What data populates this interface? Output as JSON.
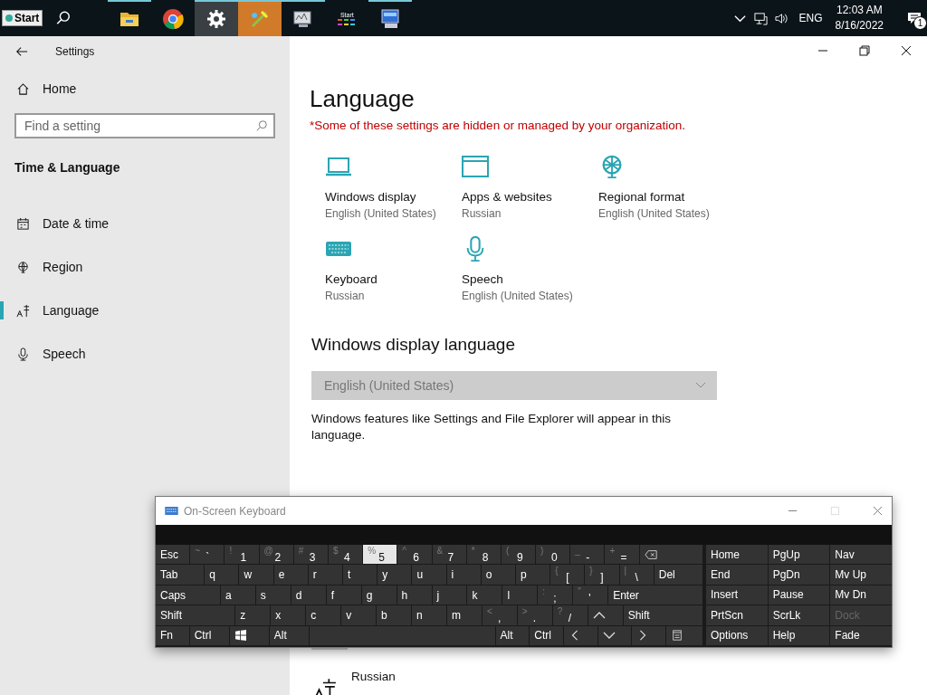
{
  "taskbar": {
    "start": "Start",
    "apps": [
      {
        "kind": "folder",
        "running": true,
        "selected": false,
        "flashing": false
      },
      {
        "kind": "chrome",
        "running": false,
        "selected": false,
        "flashing": false
      },
      {
        "kind": "gear",
        "running": true,
        "selected": true,
        "flashing": false
      },
      {
        "kind": "paint",
        "running": true,
        "selected": false,
        "flashing": true
      },
      {
        "kind": "monitor",
        "running": true,
        "selected": false,
        "flashing": false
      },
      {
        "kind": "grid",
        "label": "Start",
        "running": false,
        "selected": false,
        "flashing": false
      },
      {
        "kind": "computer",
        "running": true,
        "selected": false,
        "flashing": false
      }
    ],
    "tray": {
      "language": "ENG",
      "time": "12:03 AM",
      "date": "8/16/2022",
      "notifications": "1"
    }
  },
  "window": {
    "title": "Settings"
  },
  "sidebar": {
    "home": "Home",
    "search": {
      "placeholder": "Find a setting"
    },
    "section": "Time & Language",
    "items": [
      {
        "kind": "calendar",
        "label": "Date & time",
        "selected": false
      },
      {
        "kind": "globe",
        "label": "Region",
        "selected": false
      },
      {
        "kind": "language",
        "label": "Language",
        "selected": true
      },
      {
        "kind": "mic",
        "label": "Speech",
        "selected": false
      }
    ]
  },
  "main": {
    "heading": "Language",
    "notice": "*Some of these settings are hidden or managed by your organization.",
    "tiles": [
      {
        "kind": "laptop",
        "title": "Windows display",
        "value": "English (United States)"
      },
      {
        "kind": "window",
        "title": "Apps & websites",
        "value": "Russian"
      },
      {
        "kind": "globe",
        "title": "Regional format",
        "value": "English (United States)"
      },
      {
        "kind": "keyboard",
        "title": "Keyboard",
        "value": "Russian"
      },
      {
        "kind": "mic",
        "title": "Speech",
        "value": "English (United States)"
      }
    ],
    "display_language": {
      "heading": "Windows display language",
      "dropdown": {
        "value": "English (United States)",
        "disabled": true
      },
      "description": "Windows features like Settings and File Explorer will appear in this language."
    },
    "preferred": [
      {
        "name": "Russian"
      }
    ]
  },
  "osk": {
    "title": "On-Screen Keyboard",
    "rows": [
      {
        "keys": [
          {
            "label": "Esc",
            "pressed": false
          },
          {
            "label": "`",
            "shift": "~",
            "pressed": false
          },
          {
            "label": "1",
            "shift": "!",
            "pressed": false
          },
          {
            "label": "2",
            "shift": "@",
            "pressed": false
          },
          {
            "label": "3",
            "shift": "#",
            "pressed": false
          },
          {
            "label": "4",
            "shift": "$",
            "pressed": false
          },
          {
            "label": "5",
            "shift": "%",
            "pressed": true
          },
          {
            "label": "6",
            "shift": "^",
            "pressed": false
          },
          {
            "label": "7",
            "shift": "&",
            "pressed": false
          },
          {
            "label": "8",
            "shift": "*",
            "pressed": false
          },
          {
            "label": "9",
            "shift": "(",
            "pressed": false
          },
          {
            "label": "0",
            "shift": ")",
            "pressed": false
          },
          {
            "label": "-",
            "shift": "_",
            "pressed": false
          },
          {
            "label": "=",
            "shift": "+",
            "pressed": false
          },
          {
            "kind": "backspace",
            "pressed": false
          }
        ]
      },
      {
        "keys": [
          {
            "label": "Tab",
            "pressed": false
          },
          {
            "label": "q",
            "pressed": false
          },
          {
            "label": "w",
            "pressed": false
          },
          {
            "label": "e",
            "pressed": false
          },
          {
            "label": "r",
            "pressed": false
          },
          {
            "label": "t",
            "pressed": false
          },
          {
            "label": "y",
            "pressed": false
          },
          {
            "label": "u",
            "pressed": false
          },
          {
            "label": "i",
            "pressed": false
          },
          {
            "label": "o",
            "pressed": false
          },
          {
            "label": "p",
            "pressed": false
          },
          {
            "label": "[",
            "shift": "{",
            "pressed": false
          },
          {
            "label": "]",
            "shift": "}",
            "pressed": false
          },
          {
            "label": "\\",
            "shift": "|",
            "pressed": false
          },
          {
            "label": "Del",
            "pressed": false
          }
        ]
      },
      {
        "keys": [
          {
            "label": "Caps",
            "pressed": false
          },
          {
            "label": "a",
            "pressed": false
          },
          {
            "label": "s",
            "pressed": false
          },
          {
            "label": "d",
            "pressed": false
          },
          {
            "label": "f",
            "pressed": false
          },
          {
            "label": "g",
            "pressed": false
          },
          {
            "label": "h",
            "pressed": false
          },
          {
            "label": "j",
            "pressed": false
          },
          {
            "label": "k",
            "pressed": false
          },
          {
            "label": "l",
            "pressed": false
          },
          {
            "label": ";",
            "shift": ":",
            "pressed": false
          },
          {
            "label": "'",
            "shift": "\"",
            "pressed": false
          },
          {
            "label": "Enter",
            "pressed": false
          }
        ]
      },
      {
        "keys": [
          {
            "label": "Shift",
            "pressed": false
          },
          {
            "label": "z",
            "pressed": false
          },
          {
            "label": "x",
            "pressed": false
          },
          {
            "label": "c",
            "pressed": false
          },
          {
            "label": "v",
            "pressed": false
          },
          {
            "label": "b",
            "pressed": false
          },
          {
            "label": "n",
            "pressed": false
          },
          {
            "label": "m",
            "pressed": false
          },
          {
            "label": ",",
            "shift": "<",
            "pressed": false
          },
          {
            "label": ".",
            "shift": ">",
            "pressed": false
          },
          {
            "label": "/",
            "shift": "?",
            "pressed": false
          },
          {
            "kind": "up",
            "pressed": false
          },
          {
            "label": "Shift",
            "pressed": false
          }
        ]
      },
      {
        "keys": [
          {
            "label": "Fn",
            "pressed": false
          },
          {
            "label": "Ctrl",
            "pressed": false
          },
          {
            "kind": "windows",
            "pressed": false
          },
          {
            "label": "Alt",
            "pressed": false
          },
          {
            "kind": "space",
            "pressed": false
          },
          {
            "label": "Alt",
            "pressed": false
          },
          {
            "label": "Ctrl",
            "pressed": false
          },
          {
            "kind": "left",
            "pressed": false
          },
          {
            "kind": "down",
            "pressed": false
          },
          {
            "kind": "right",
            "pressed": false
          },
          {
            "kind": "menu",
            "pressed": false
          }
        ]
      }
    ],
    "nav": [
      {
        "label": "Home",
        "disabled": false
      },
      {
        "label": "PgUp",
        "disabled": false
      },
      {
        "label": "Nav",
        "disabled": false
      },
      {
        "label": "End",
        "disabled": false
      },
      {
        "label": "PgDn",
        "disabled": false
      },
      {
        "label": "Mv Up",
        "disabled": false
      },
      {
        "label": "Insert",
        "disabled": false
      },
      {
        "label": "Pause",
        "disabled": false
      },
      {
        "label": "Mv Dn",
        "disabled": false
      },
      {
        "label": "PrtScn",
        "disabled": false
      },
      {
        "label": "ScrLk",
        "disabled": false
      },
      {
        "label": "Dock",
        "disabled": true
      },
      {
        "label": "Options",
        "disabled": false
      },
      {
        "label": "Help",
        "disabled": false
      },
      {
        "label": "Fade",
        "disabled": false
      }
    ]
  }
}
